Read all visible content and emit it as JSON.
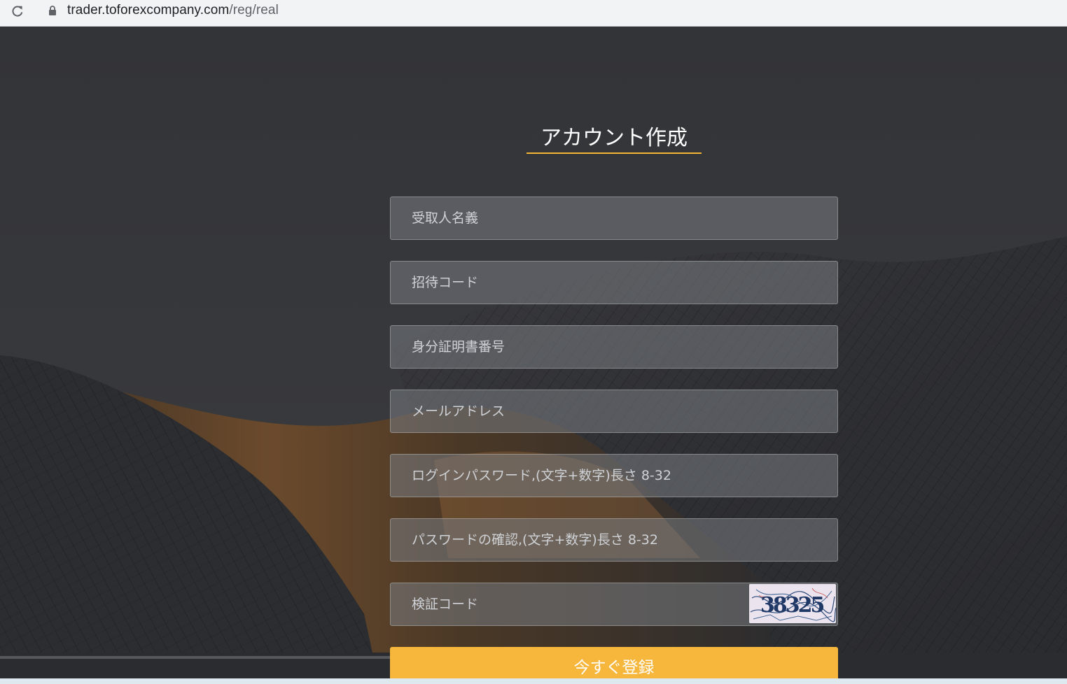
{
  "browser": {
    "url_host": "trader.toforexcompany.com",
    "url_path": "/reg/real"
  },
  "form": {
    "title": "アカウント作成",
    "fields": [
      {
        "placeholder": "受取人名義",
        "value": ""
      },
      {
        "placeholder": "招待コード",
        "value": ""
      },
      {
        "placeholder": "身分証明書番号",
        "value": ""
      },
      {
        "placeholder": "メールアドレス",
        "value": ""
      },
      {
        "placeholder": "ログインパスワード,(文字+数字)長さ 8-32",
        "value": ""
      },
      {
        "placeholder": "パスワードの確認,(文字+数字)長さ 8-32",
        "value": ""
      },
      {
        "placeholder": "検証コード",
        "value": ""
      }
    ],
    "captcha_text": "38325",
    "submit_label": "今すぐ登録"
  },
  "colors": {
    "accent": "#f6b73c",
    "page_bg": "#36373b",
    "field_bg": "#787c82"
  },
  "icons": {
    "reload": "reload-icon",
    "lock": "lock-icon",
    "captcha": "captcha-image"
  }
}
